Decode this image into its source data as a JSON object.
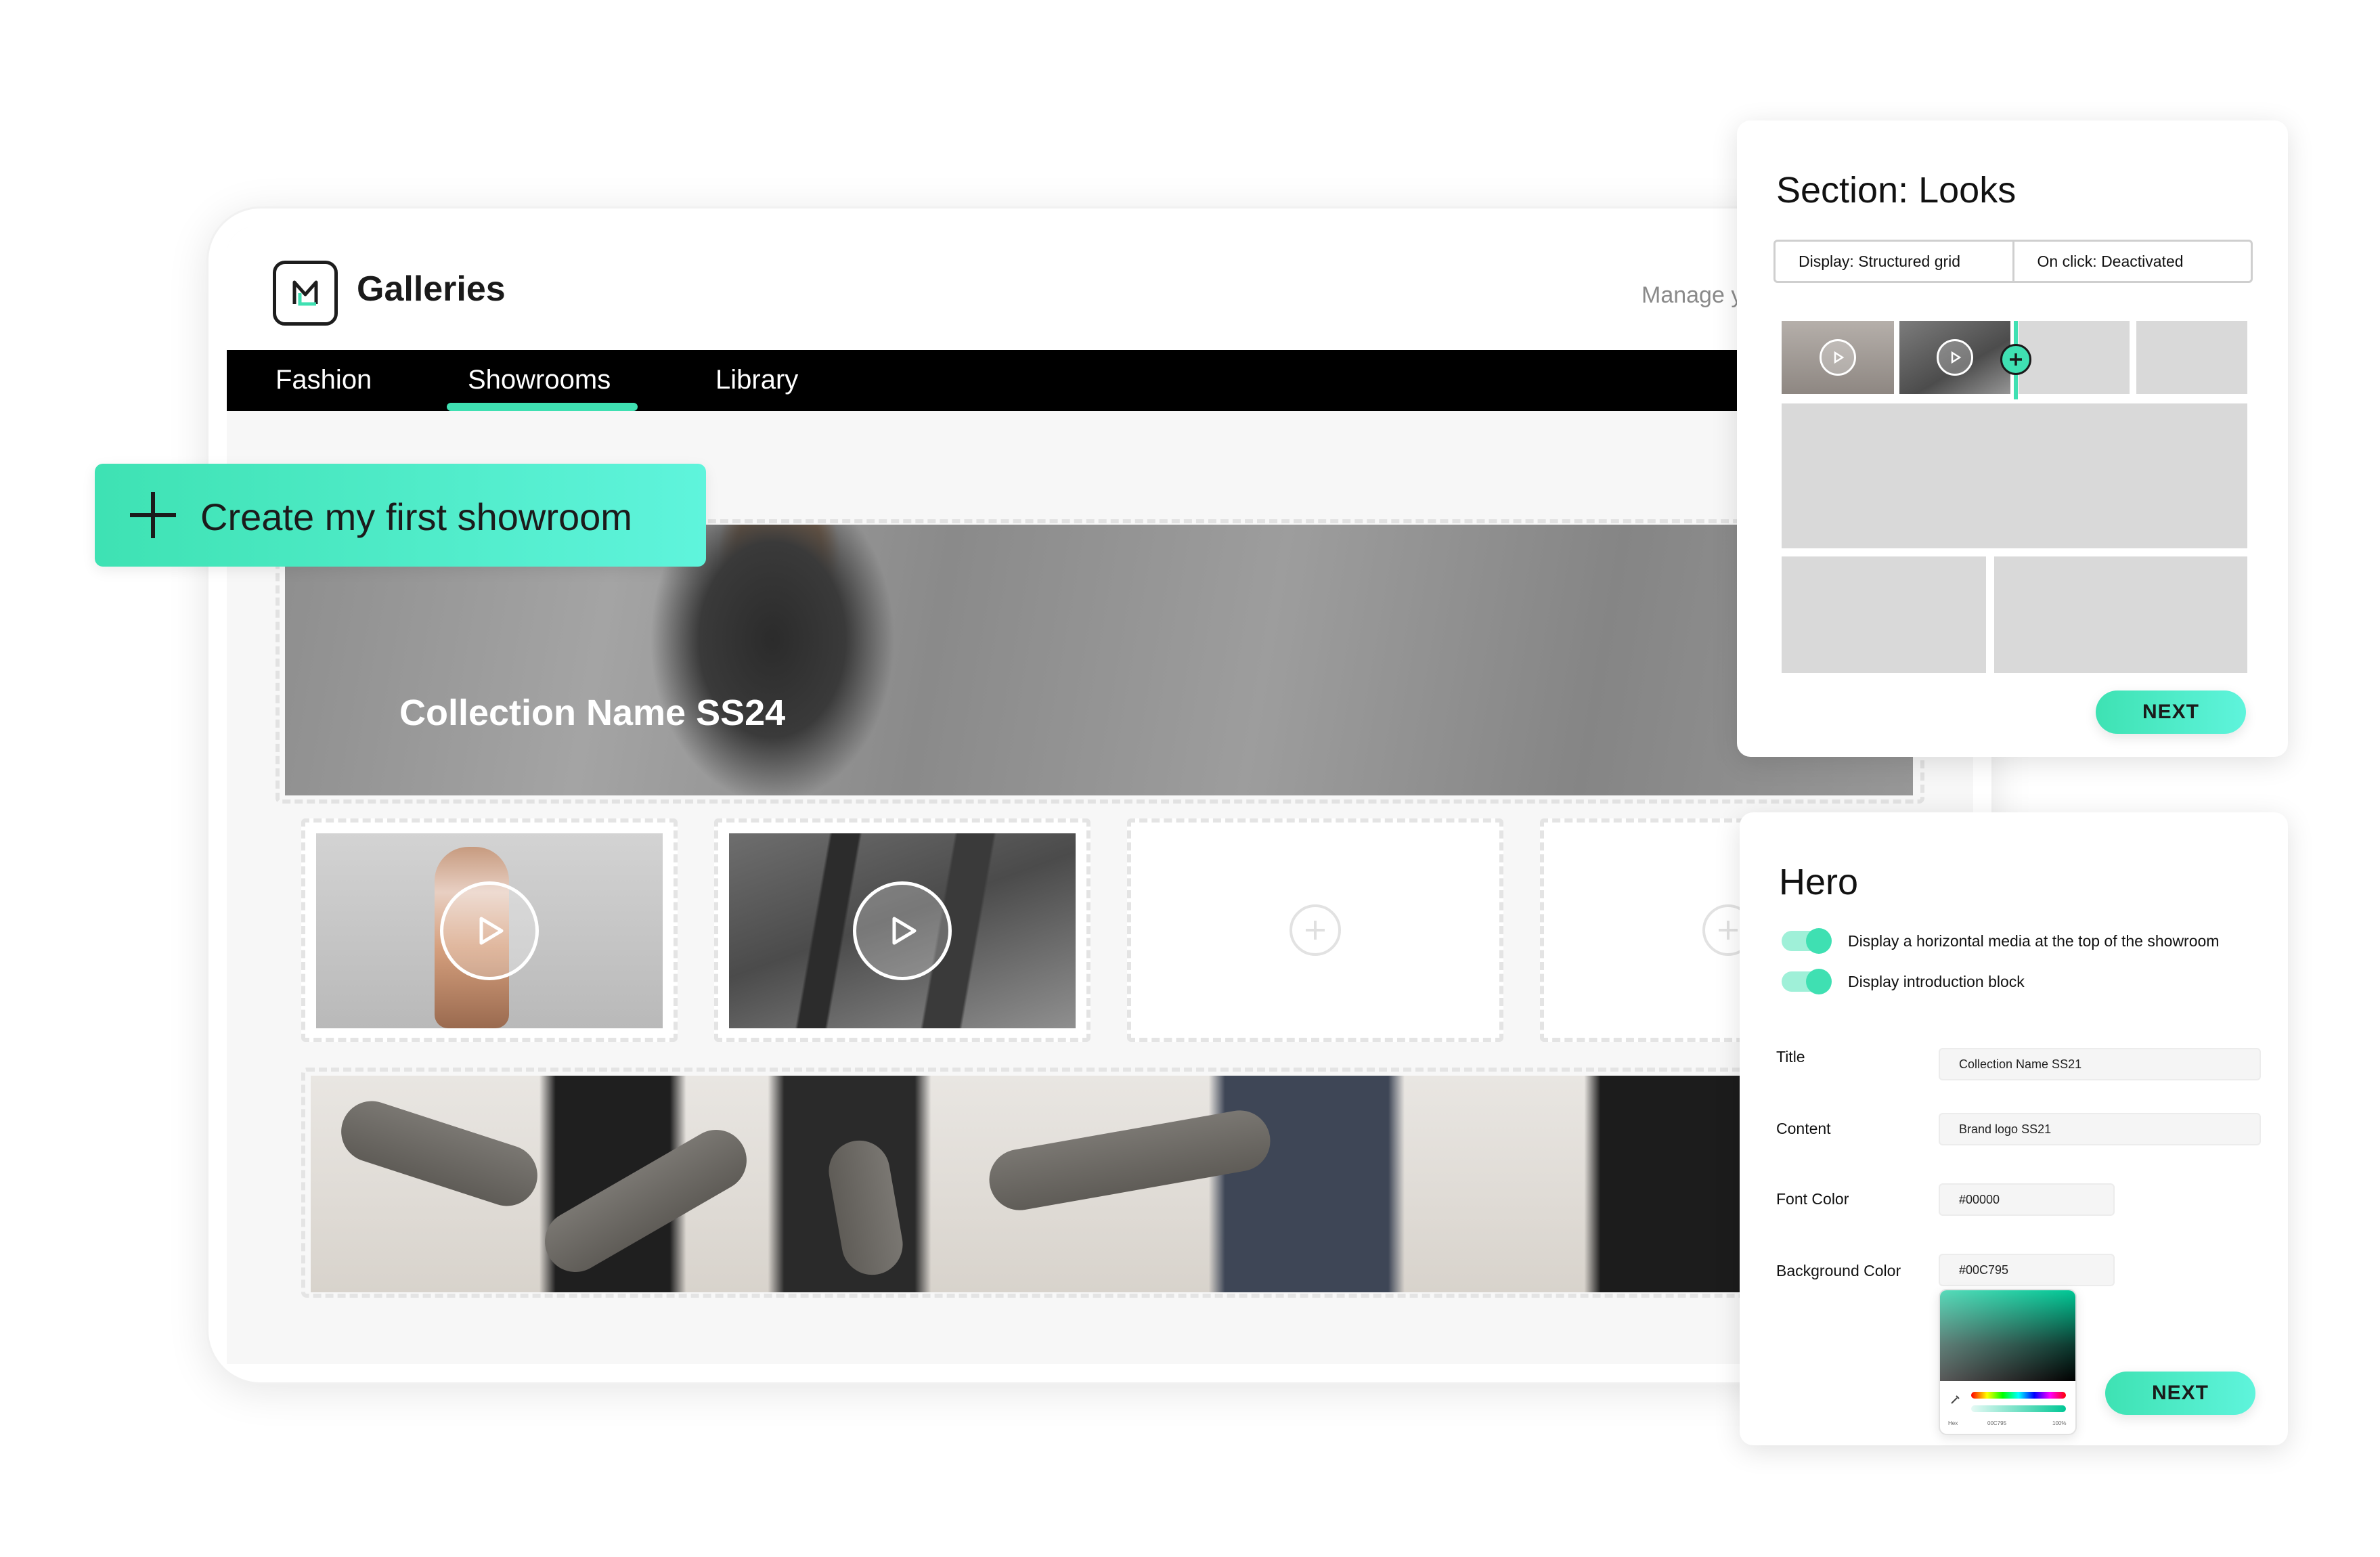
{
  "app": {
    "title": "Galleries",
    "manage_text": "Manage y",
    "nav": [
      {
        "label": "Fashion"
      },
      {
        "label": "Showrooms",
        "active": true
      },
      {
        "label": "Library"
      }
    ]
  },
  "create_button": {
    "label": "Create my first showroom"
  },
  "hero_banner": {
    "title": "Collection Name SS24"
  },
  "tiles": [
    {
      "type": "video"
    },
    {
      "type": "video"
    },
    {
      "type": "empty"
    },
    {
      "type": "empty"
    }
  ],
  "looks_panel": {
    "title": "Section: Looks",
    "display": "Display: Structured grid",
    "on_click": "On click: Deactivated",
    "next_label": "NEXT"
  },
  "hero_panel": {
    "title": "Hero",
    "toggles": [
      {
        "label": "Display a horizontal media at the top of the showroom",
        "on": true
      },
      {
        "label": "Display introduction block",
        "on": true
      }
    ],
    "fields": {
      "title_label": "Title",
      "title_value": "Collection Name SS21",
      "content_label": "Content",
      "content_value": "Brand logo SS21",
      "font_color_label": "Font Color",
      "font_color_value": "#00000",
      "bg_color_label": "Background Color",
      "bg_color_value": "#00C795"
    },
    "picker": {
      "hex_label": "Hex",
      "hex_value": "00C795",
      "alpha": "100%"
    },
    "next_label": "NEXT"
  },
  "colors": {
    "accent": "#3FE0B2",
    "accent_light": "#5FF4DC",
    "nav_bg": "#000000",
    "picker_selected": "#00C795"
  },
  "icons": {
    "logo": "galleries-logo-icon",
    "play": "play-icon",
    "plus": "plus-icon",
    "eyedropper": "eyedropper-icon"
  }
}
